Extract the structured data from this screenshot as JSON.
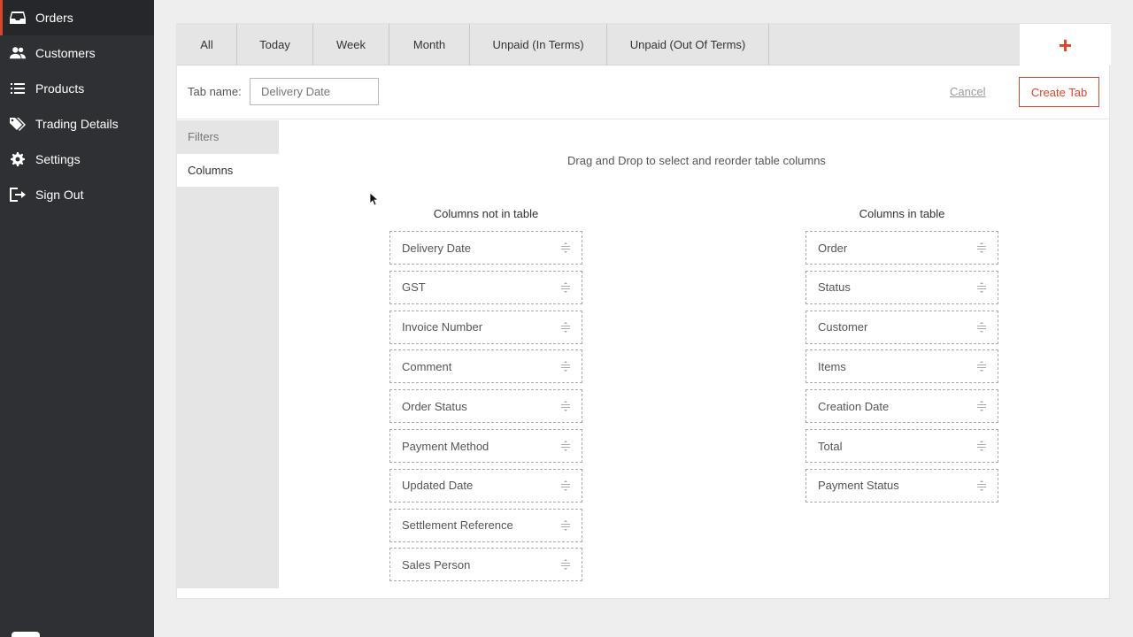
{
  "sidebar": {
    "items": [
      {
        "label": "Orders",
        "icon": "inbox-icon",
        "active": true
      },
      {
        "label": "Customers",
        "icon": "users-icon"
      },
      {
        "label": "Products",
        "icon": "list-icon"
      },
      {
        "label": "Trading Details",
        "icon": "tags-icon"
      },
      {
        "label": "Settings",
        "icon": "gear-icon"
      },
      {
        "label": "Sign Out",
        "icon": "sign-out-icon"
      }
    ]
  },
  "tabs": [
    "All",
    "Today",
    "Week",
    "Month",
    "Unpaid (In Terms)",
    "Unpaid (Out Of Terms)"
  ],
  "add_tab_symbol": "+",
  "tab_form": {
    "label": "Tab name:",
    "placeholder": "Delivery Date",
    "cancel_label": "Cancel",
    "create_label": "Create Tab"
  },
  "side_tabs": [
    "Filters",
    "Columns"
  ],
  "columns": {
    "hint": "Drag and Drop to select and reorder table columns",
    "not_in_table_heading": "Columns not in table",
    "in_table_heading": "Columns in table",
    "not_in_table": [
      "Delivery Date",
      "GST",
      "Invoice Number",
      "Comment",
      "Order Status",
      "Payment Method",
      "Updated Date",
      "Settlement Reference",
      "Sales Person"
    ],
    "in_table": [
      "Order",
      "Status",
      "Customer",
      "Items",
      "Creation Date",
      "Total",
      "Payment Status"
    ]
  },
  "colors": {
    "accent": "#d9472b",
    "sidebar": "#2f3033"
  }
}
